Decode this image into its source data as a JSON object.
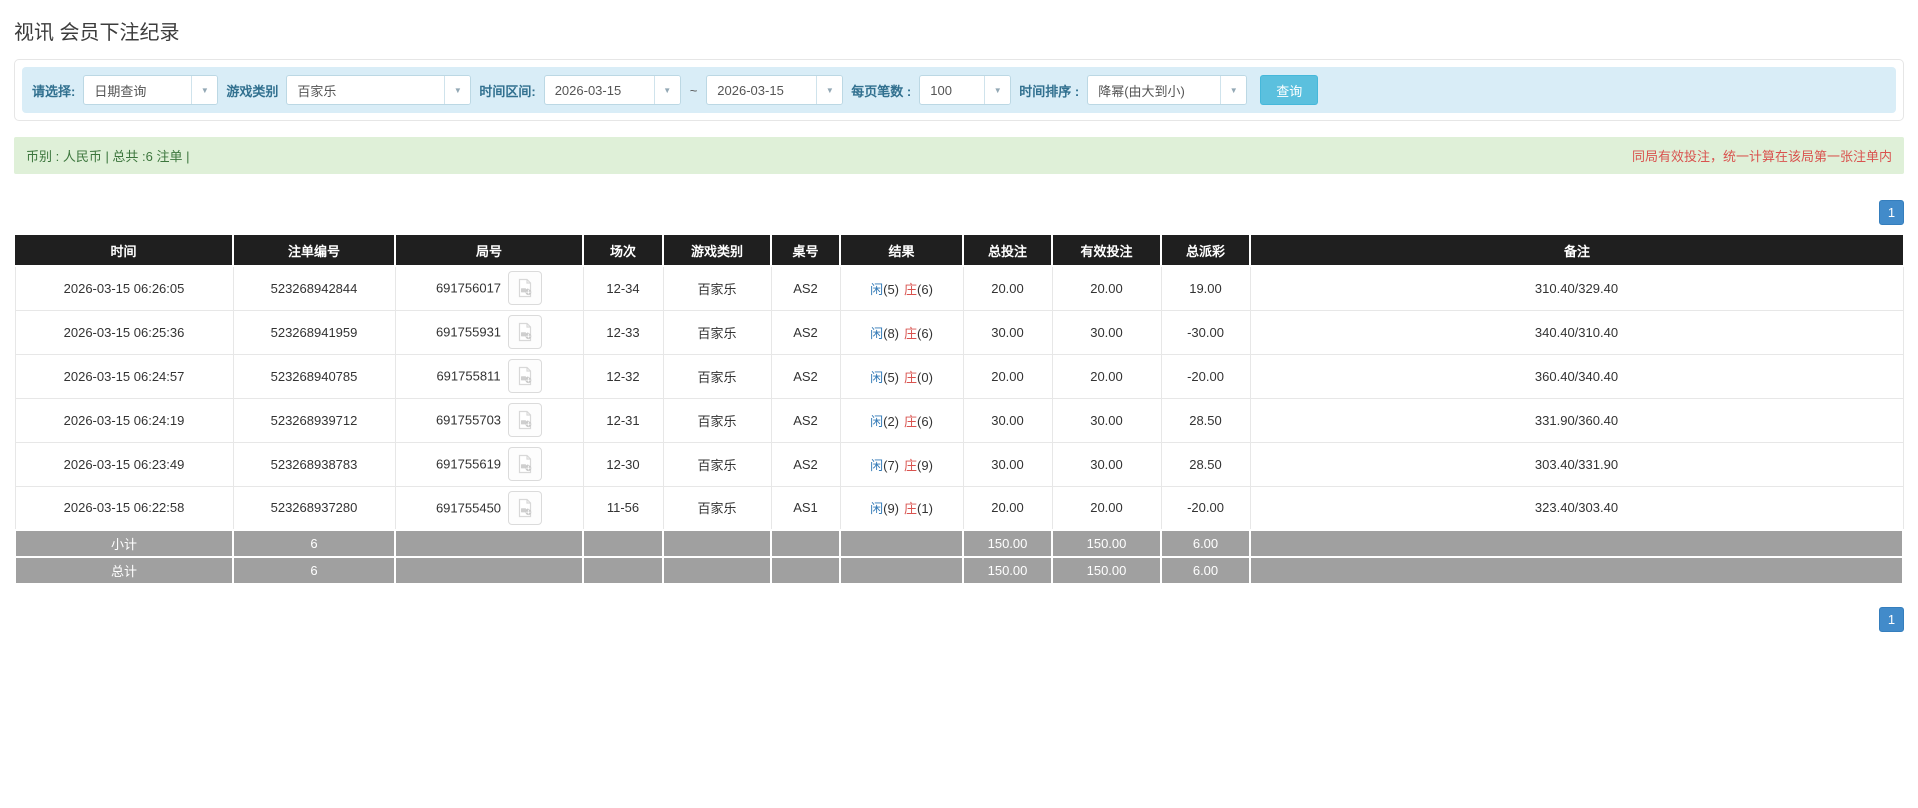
{
  "page": {
    "title": "视讯 会员下注纪录"
  },
  "filters": {
    "mode_label": "请选择:",
    "mode_value": "日期查询",
    "game_type_label": "游戏类别",
    "game_type_value": "百家乐",
    "time_range_label": "时间区间:",
    "date_from": "2026-03-15",
    "date_separator": "~",
    "date_to": "2026-03-15",
    "page_size_label": "每页笔数 :",
    "page_size_value": "100",
    "sort_label": "时间排序 :",
    "sort_value": "降幂(由大到小)",
    "query_button": "查询"
  },
  "summary_bar": {
    "left_text": "币别 : 人民币 | 总共 :6 注单 |",
    "right_text": "同局有效投注，统一计算在该局第一张注单内"
  },
  "pagination": {
    "current_page": "1"
  },
  "icons": {
    "select_caret": "▼"
  },
  "colors": {
    "header_bg": "#1f1f1f",
    "filter_bar_bg": "#d9edf7",
    "filter_label": "#31708f",
    "summary_bar_bg": "#dff0d8",
    "summary_left_text": "#3c763d",
    "summary_right_text": "#d9534f",
    "query_button_bg": "#5bc0de",
    "pagination_bg": "#428bca",
    "link_blue": "#337ab7",
    "negative_red": "#d9534f",
    "summary_row_bg": "#a0a0a0"
  },
  "table": {
    "headers": [
      "时间",
      "注单编号",
      "局号",
      "场次",
      "游戏类别",
      "桌号",
      "结果",
      "总投注",
      "有效投注",
      "总派彩",
      "备注"
    ],
    "rows": [
      {
        "time": "2026-03-15 06:26:05",
        "bet_id": "523268942844",
        "round": "691756017",
        "session": "12-34",
        "game_type": "百家乐",
        "table_no": "AS2",
        "result": {
          "player": "闲",
          "player_score": "(5)",
          "banker": "庄",
          "banker_score": "(6)"
        },
        "total_bet": "20.00",
        "valid_bet": "20.00",
        "payout": "19.00",
        "remark": "310.40/329.40"
      },
      {
        "time": "2026-03-15 06:25:36",
        "bet_id": "523268941959",
        "round": "691755931",
        "session": "12-33",
        "game_type": "百家乐",
        "table_no": "AS2",
        "result": {
          "player": "闲",
          "player_score": "(8)",
          "banker": "庄",
          "banker_score": "(6)"
        },
        "total_bet": "30.00",
        "valid_bet": "30.00",
        "payout": "-30.00",
        "remark": "340.40/310.40"
      },
      {
        "time": "2026-03-15 06:24:57",
        "bet_id": "523268940785",
        "round": "691755811",
        "session": "12-32",
        "game_type": "百家乐",
        "table_no": "AS2",
        "result": {
          "player": "闲",
          "player_score": "(5)",
          "banker": "庄",
          "banker_score": "(0)"
        },
        "total_bet": "20.00",
        "valid_bet": "20.00",
        "payout": "-20.00",
        "remark": "360.40/340.40"
      },
      {
        "time": "2026-03-15 06:24:19",
        "bet_id": "523268939712",
        "round": "691755703",
        "session": "12-31",
        "game_type": "百家乐",
        "table_no": "AS2",
        "result": {
          "player": "闲",
          "player_score": "(2)",
          "banker": "庄",
          "banker_score": "(6)"
        },
        "total_bet": "30.00",
        "valid_bet": "30.00",
        "payout": "28.50",
        "remark": "331.90/360.40"
      },
      {
        "time": "2026-03-15 06:23:49",
        "bet_id": "523268938783",
        "round": "691755619",
        "session": "12-30",
        "game_type": "百家乐",
        "table_no": "AS2",
        "result": {
          "player": "闲",
          "player_score": "(7)",
          "banker": "庄",
          "banker_score": "(9)"
        },
        "total_bet": "30.00",
        "valid_bet": "30.00",
        "payout": "28.50",
        "remark": "303.40/331.90"
      },
      {
        "time": "2026-03-15 06:22:58",
        "bet_id": "523268937280",
        "round": "691755450",
        "session": "11-56",
        "game_type": "百家乐",
        "table_no": "AS1",
        "result": {
          "player": "闲",
          "player_score": "(9)",
          "banker": "庄",
          "banker_score": "(1)"
        },
        "total_bet": "20.00",
        "valid_bet": "20.00",
        "payout": "-20.00",
        "remark": "323.40/303.40"
      }
    ],
    "subtotal": {
      "label": "小计",
      "count": "6",
      "total_bet": "150.00",
      "valid_bet": "150.00",
      "payout": "6.00"
    },
    "total": {
      "label": "总计",
      "count": "6",
      "total_bet": "150.00",
      "valid_bet": "150.00",
      "payout": "6.00"
    }
  }
}
